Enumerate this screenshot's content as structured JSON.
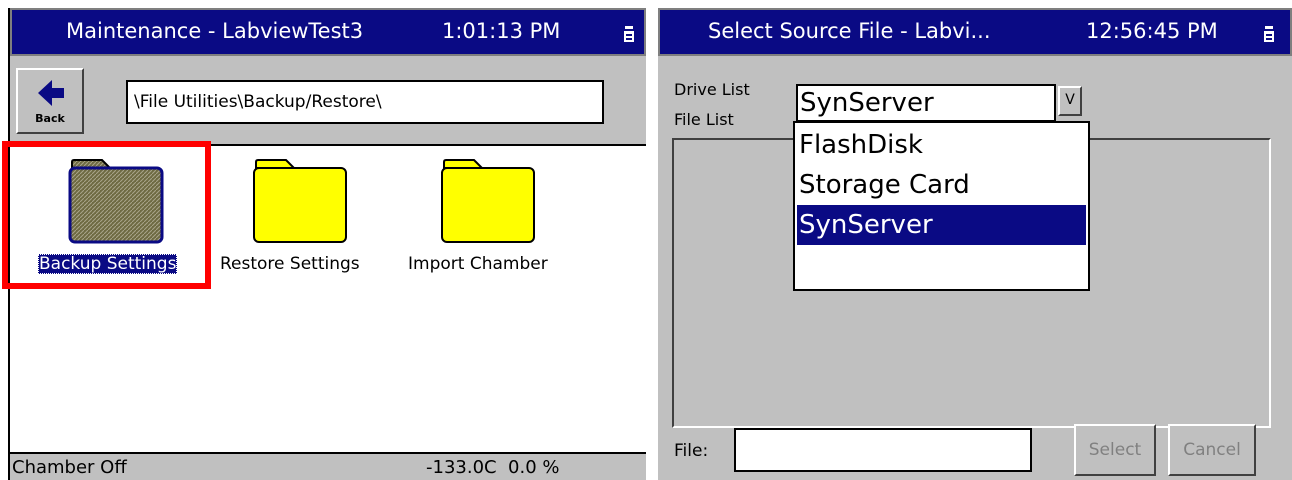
{
  "left_screen": {
    "title": "Maintenance - LabviewTest3",
    "clock": "1:01:13 PM",
    "back_label": "Back",
    "path": "\\File Utilities\\Backup/Restore\\",
    "folders": [
      {
        "label": "Backup Settings",
        "selected": true
      },
      {
        "label": "Restore Settings",
        "selected": false
      },
      {
        "label": "Import Chamber",
        "selected": false
      }
    ],
    "status_left": "Chamber Off",
    "status_right": "-133.0C  0.0 %",
    "highlight_color": "#ff0000"
  },
  "right_screen": {
    "title": "Select Source File - Labvi...",
    "clock": "12:56:45 PM",
    "drive_list_label": "Drive List",
    "file_list_label": "File List",
    "drive_value": "SynServer",
    "dropdown_toggle": "V",
    "drive_options": [
      {
        "label": "FlashDisk",
        "selected": false
      },
      {
        "label": "Storage Card",
        "selected": false
      },
      {
        "label": "SynServer",
        "selected": true
      }
    ],
    "file_label": "File:",
    "file_value": "",
    "select_label": "Select",
    "cancel_label": "Cancel"
  },
  "colors": {
    "title_bar": "#0a0a84",
    "selection": "#0a0a84",
    "panel_gray": "#c0c0c0",
    "folder_yellow": "#ffff00",
    "folder_selected": "#6e6a42"
  }
}
